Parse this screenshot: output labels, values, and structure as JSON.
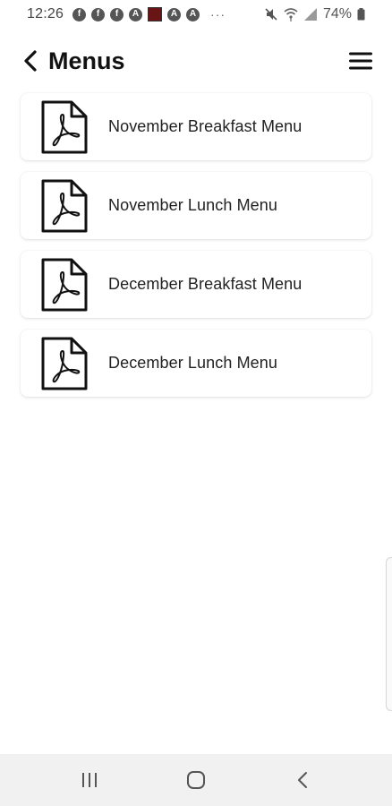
{
  "status_bar": {
    "time": "12:26",
    "notification_icons": [
      "facebook-icon",
      "facebook-icon",
      "facebook-icon",
      "app-a-icon",
      "red-square-app-icon",
      "app-a-icon",
      "app-a-icon"
    ],
    "more_dots": "···",
    "battery_percent": "74%"
  },
  "header": {
    "title": "Menus"
  },
  "menus": {
    "items": [
      {
        "label": "November Breakfast Menu",
        "icon": "pdf-file-icon"
      },
      {
        "label": "November Lunch Menu",
        "icon": "pdf-file-icon"
      },
      {
        "label": "December Breakfast Menu",
        "icon": "pdf-file-icon"
      },
      {
        "label": "December Lunch Menu",
        "icon": "pdf-file-icon"
      }
    ]
  },
  "colors": {
    "background": "#ffffff",
    "text": "#111111",
    "nav_bar": "#f1f1f1"
  }
}
